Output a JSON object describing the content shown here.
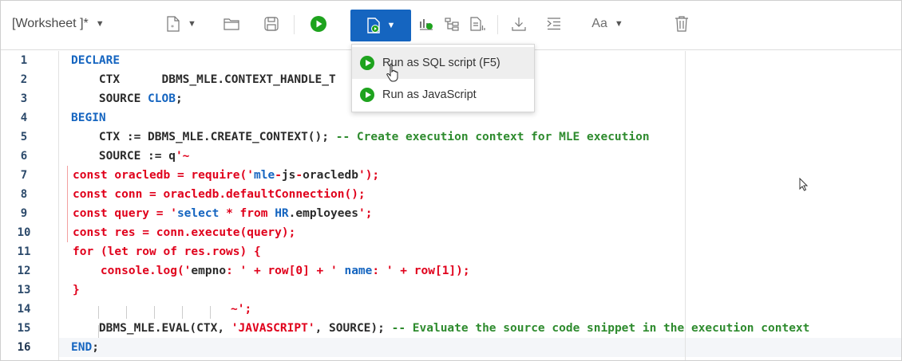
{
  "toolbar": {
    "worksheet_title": "[Worksheet ]*",
    "icons": [
      "new-file-icon",
      "open-folder-icon",
      "save-icon",
      "run-icon",
      "run-split-icon",
      "explain-plan-icon",
      "autotrace-icon",
      "sql-history-icon",
      "download-icon",
      "format-icon",
      "text-case-icon",
      "delete-icon"
    ],
    "text_case_label": "Aa"
  },
  "run_menu": {
    "items": [
      {
        "label": "Run as SQL script (F5)"
      },
      {
        "label": "Run as JavaScript"
      }
    ]
  },
  "editor": {
    "line_numbers": [
      "1",
      "2",
      "3",
      "4",
      "5",
      "6",
      "7",
      "8",
      "9",
      "10",
      "11",
      "12",
      "13",
      "14",
      "15",
      "16"
    ],
    "active_line": "16",
    "lines": {
      "l1": {
        "kw": "DECLARE"
      },
      "l2": {
        "a": "    CTX      DBMS_MLE.CONTEXT_HANDLE_T"
      },
      "l3": {
        "a": "    SOURCE ",
        "kw": "CLOB",
        "b": ";"
      },
      "l4": {
        "kw": "BEGIN"
      },
      "l5": {
        "a": "    CTX := DBMS_MLE.CREATE_CONTEXT(); ",
        "cm": "-- Create execution context for MLE execution"
      },
      "l6": {
        "a": "    SOURCE := q",
        "str": "'~"
      },
      "l7": {
        "a": "const oracledb = require('",
        "s": "mle",
        "b": "-",
        "c": "js",
        "d": "-",
        "e": "oracledb",
        "f": "');"
      },
      "l8": {
        "a": "const conn = oracledb.defaultConnection();"
      },
      "l9": {
        "a": "const query = '",
        "s1": "select",
        "b": " * from ",
        "s2": "HR",
        "c": ".employees",
        "d": "';"
      },
      "l10": {
        "a": "const res = conn.execute(query);"
      },
      "l11": {
        "a": "for (let row of res.rows) {"
      },
      "l12": {
        "a": "    console.log('",
        "s1": "empno",
        "b": ": ' + row[0] + ' ",
        "s2": "name",
        "c": ": ' + row[1]);"
      },
      "l13": {
        "a": "}"
      },
      "l14": {
        "a": "~';"
      },
      "l15": {
        "a": "    DBMS_MLE.EVAL(CTX, ",
        "str": "'JAVASCRIPT'",
        "b": ", SOURCE); ",
        "cm": "-- Evaluate the source code snippet in the execution context"
      },
      "l16": {
        "kw": "END",
        "b": ";"
      }
    }
  },
  "colors": {
    "accent": "#1565c0",
    "run_green": "#1ea31e",
    "comment": "#2e8b2e",
    "string": "#e0001b"
  }
}
